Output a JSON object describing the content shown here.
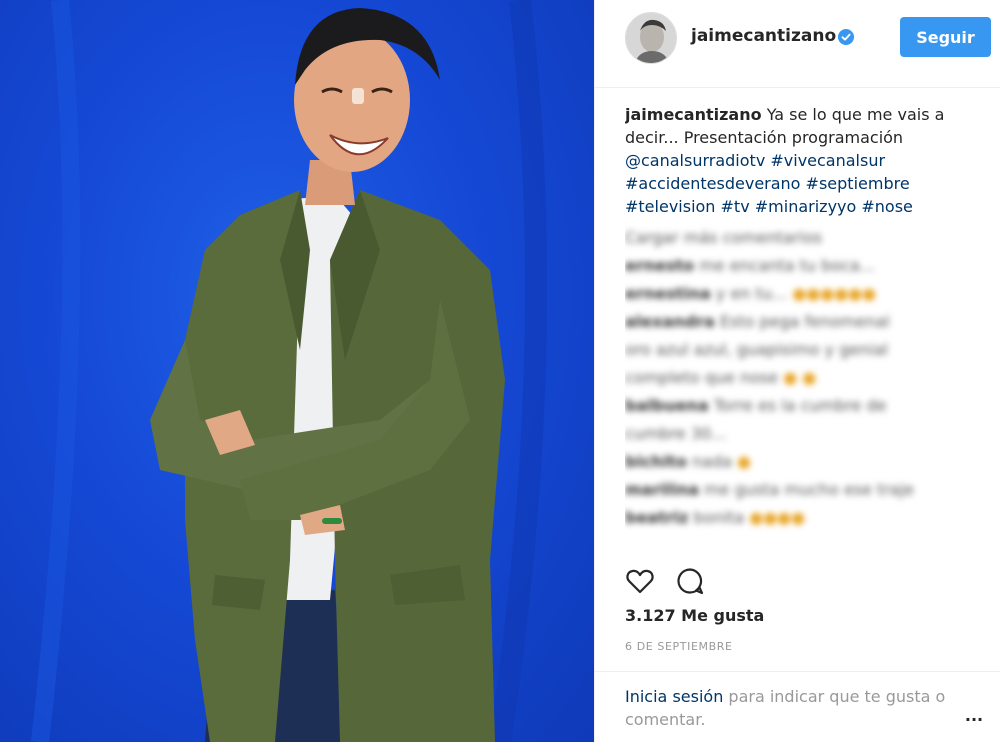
{
  "post": {
    "username": "jaimecantizano",
    "follow_label": "Seguir",
    "caption_user": "jaimecantizano",
    "caption_text": "Ya se lo que me vais a decir... Presentación programación",
    "caption_tags": "@canalsurradiotv #vivecanalsur #accidentesdeverano #septiembre #television #tv #minarizyyo #nose",
    "likes": "3.127 Me gusta",
    "date": "6 DE SEPTIEMBRE"
  },
  "blurred_comments": [
    {
      "user": "",
      "text": "Cargar más comentarios"
    },
    {
      "user": "ernesto",
      "text": "me encanta tu boca..."
    },
    {
      "user": "ernestina",
      "text": "y en tu...",
      "emoji": "●●●●●●"
    },
    {
      "user": "alexandra",
      "text": "Esto pega fenomenal"
    },
    {
      "user": "",
      "text": "oro azul azul, guapisimo y genial"
    },
    {
      "user": "",
      "text": "completo que nose",
      "emoji": "● ●"
    },
    {
      "user": "balbuena",
      "text": "Torre es la cumbre de"
    },
    {
      "user": "",
      "text": "cumbre 30..."
    },
    {
      "user": "bichito",
      "text": "nada",
      "emoji": "●"
    },
    {
      "user": "marilina",
      "text": "me gusta mucho ese traje"
    },
    {
      "user": "beatriz",
      "text": "bonita",
      "emoji": "●●●●"
    }
  ],
  "footer": {
    "login_link": "Inicia sesión",
    "login_rest": " para indicar que te gusta o comentar.",
    "more": "..."
  },
  "colors": {
    "accent": "#3897f0",
    "link": "#003569",
    "backdrop": "#1549d6",
    "jacket": "#5a6b3c"
  },
  "icons": [
    "verified-badge-icon",
    "heart-icon",
    "comment-icon",
    "more-options-icon"
  ]
}
